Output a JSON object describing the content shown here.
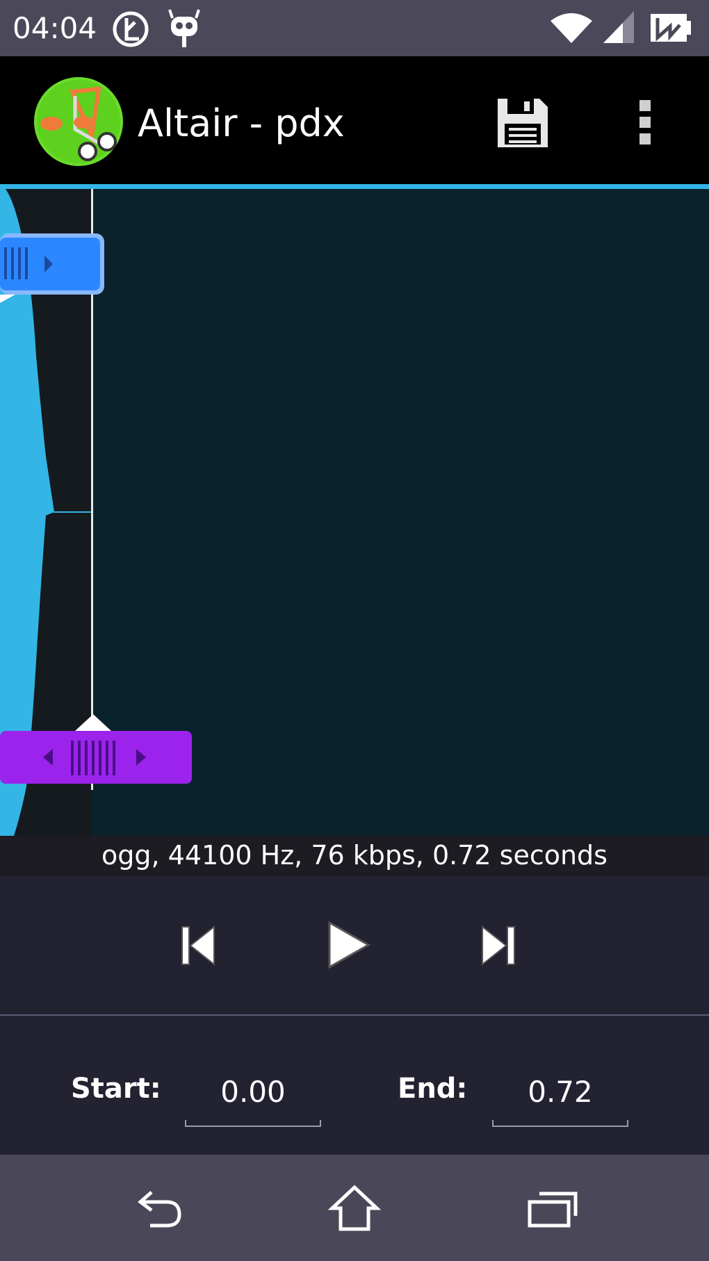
{
  "status_bar": {
    "time": "04:04",
    "icons": [
      "bootloader-unlock-icon",
      "cyanogenmod-icon",
      "wifi-icon",
      "cell-signal-icon",
      "battery-charging-icon"
    ]
  },
  "action_bar": {
    "title": "Altair - pdx",
    "app_icon": "ringdroid-app-icon",
    "actions": [
      "save-icon",
      "overflow-menu-icon"
    ]
  },
  "waveform": {
    "start_marker_icon": "start-marker-handle-icon",
    "end_marker_icon": "end-marker-handle-icon"
  },
  "info": {
    "text": "ogg, 44100 Hz, 76 kbps, 0.72 seconds"
  },
  "transport": {
    "buttons": [
      "skip-previous-icon",
      "play-icon",
      "skip-next-icon"
    ]
  },
  "times": {
    "start_label": "Start:",
    "start_value": "0.00",
    "end_label": "End:",
    "end_value": "0.72"
  },
  "nav_bar": {
    "buttons": [
      "back-icon",
      "home-icon",
      "recent-apps-icon"
    ]
  },
  "colors": {
    "accent": "#33b5e5",
    "waveform": "#33b5e5",
    "start_marker": "#2b87ff",
    "end_marker": "#9b23ec",
    "background": "#0a222c"
  }
}
